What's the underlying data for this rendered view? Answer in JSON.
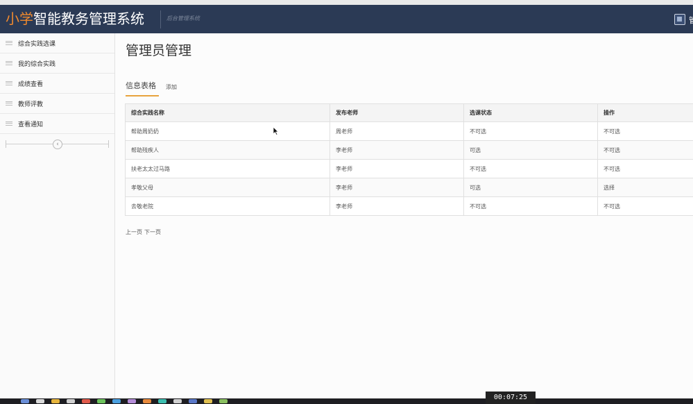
{
  "header": {
    "title_highlight": "小学",
    "title_rest": "智能教务管理系统",
    "subtitle": "后台管理系统",
    "user_initial": "管"
  },
  "sidebar": {
    "items": [
      {
        "label": "综合实践选课"
      },
      {
        "label": "我的综合实践"
      },
      {
        "label": "成绩查看"
      },
      {
        "label": "教师评教"
      },
      {
        "label": "查看通知"
      }
    ],
    "collapse_glyph": "‹"
  },
  "main": {
    "page_title": "管理员管理",
    "tabs": [
      {
        "label": "信息表格",
        "active": true
      },
      {
        "label": "添加",
        "active": false
      }
    ],
    "table": {
      "headers": [
        "综合实践名称",
        "发布老师",
        "选课状态",
        "操作"
      ],
      "rows": [
        [
          "帮助周奶奶",
          "周老师",
          "不可选",
          "不可选"
        ],
        [
          "帮助残疾人",
          "李老师",
          "可选",
          "不可选"
        ],
        [
          "扶老太太过马路",
          "李老师",
          "不可选",
          "不可选"
        ],
        [
          "孝敬父母",
          "李老师",
          "可选",
          "选择"
        ],
        [
          "去敬老院",
          "李老师",
          "不可选",
          "不可选"
        ]
      ]
    },
    "pager": {
      "prev": "上一页",
      "next": "下一页"
    }
  },
  "overlay": {
    "timestamp": "00:07:25"
  },
  "colors": {
    "header_bg": "#2b3a55",
    "brand_accent": "#f08a2e",
    "tab_underline": "#e8a33c"
  }
}
